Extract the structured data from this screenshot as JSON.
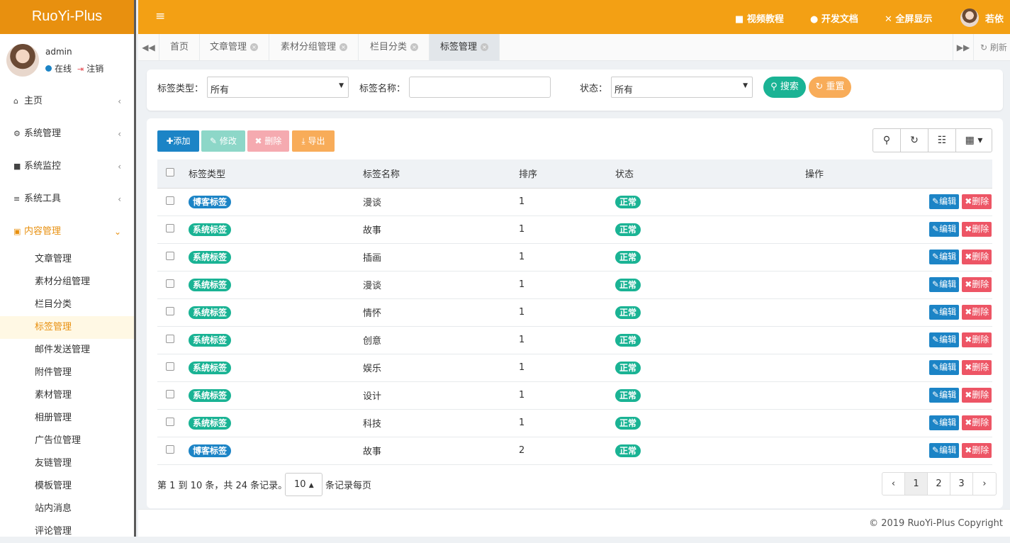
{
  "app": {
    "logo": "RuoYi-Plus"
  },
  "user": {
    "name": "admin",
    "online": "在线",
    "logout": "注销"
  },
  "menu": [
    {
      "label": "主页",
      "icon": "home-icon"
    },
    {
      "label": "系统管理",
      "icon": "gear-icon"
    },
    {
      "label": "系统监控",
      "icon": "video-icon"
    },
    {
      "label": "系统工具",
      "icon": "bars-icon"
    },
    {
      "label": "内容管理",
      "icon": "id-card-icon"
    }
  ],
  "submenu": [
    "文章管理",
    "素材分组管理",
    "栏目分类",
    "标签管理",
    "邮件发送管理",
    "附件管理",
    "素材管理",
    "相册管理",
    "广告位管理",
    "友链管理",
    "模板管理",
    "站内消息",
    "评论管理"
  ],
  "header": {
    "video": "视频教程",
    "docs": "开发文档",
    "fullscreen": "全屏显示",
    "username": "若依"
  },
  "tabs": [
    "首页",
    "文章管理",
    "素材分组管理",
    "栏目分类",
    "标签管理"
  ],
  "tabs_refresh": "刷新",
  "search": {
    "type_label": "标签类型：",
    "type_value": "所有",
    "name_label": "标签名称：",
    "name_value": "",
    "status_label": "状态：",
    "status_value": "所有",
    "search_btn": "搜索",
    "reset_btn": "重置"
  },
  "toolbar": {
    "add": "添加",
    "edit": "修改",
    "delete": "删除",
    "export": "导出"
  },
  "table": {
    "headers": [
      "标签类型",
      "标签名称",
      "排序",
      "状态",
      "操作"
    ],
    "rows": [
      {
        "type": "博客标签",
        "name": "漫谈",
        "sort": "1",
        "status": "正常"
      },
      {
        "type": "系统标签",
        "name": "故事",
        "sort": "1",
        "status": "正常"
      },
      {
        "type": "系统标签",
        "name": "插画",
        "sort": "1",
        "status": "正常"
      },
      {
        "type": "系统标签",
        "name": "漫谈",
        "sort": "1",
        "status": "正常"
      },
      {
        "type": "系统标签",
        "name": "情怀",
        "sort": "1",
        "status": "正常"
      },
      {
        "type": "系统标签",
        "name": "创意",
        "sort": "1",
        "status": "正常"
      },
      {
        "type": "系统标签",
        "name": "娱乐",
        "sort": "1",
        "status": "正常"
      },
      {
        "type": "系统标签",
        "name": "设计",
        "sort": "1",
        "status": "正常"
      },
      {
        "type": "系统标签",
        "name": "科技",
        "sort": "1",
        "status": "正常"
      },
      {
        "type": "博客标签",
        "name": "故事",
        "sort": "2",
        "status": "正常"
      }
    ],
    "edit_label": "编辑",
    "delete_label": "删除"
  },
  "pager": {
    "info": "第 1 到 10 条，共 24 条记录。",
    "size": "10",
    "suffix": "条记录每页",
    "pages": [
      "‹",
      "1",
      "2",
      "3",
      "›"
    ]
  },
  "footer": "© 2019 RuoYi-Plus Copyright",
  "colors": {
    "brand": "#f3a014",
    "blue": "#1c84c6",
    "green": "#1ab394",
    "red": "#ed5565",
    "orange": "#f8ac59"
  }
}
